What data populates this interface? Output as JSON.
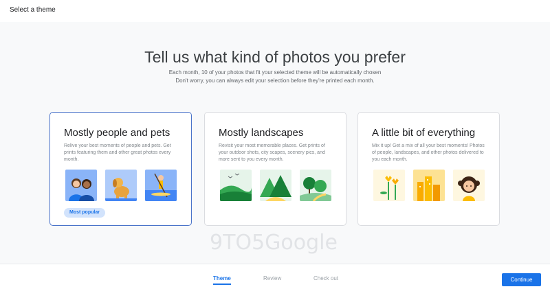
{
  "header": {
    "title": "Select a theme"
  },
  "main": {
    "headline": "Tell us what kind of photos you prefer",
    "subtitle_line1": "Each month, 10 of your photos that fit your selected theme will be automatically chosen",
    "subtitle_line2": "Don't worry, you can always edit your selection before they're printed each month."
  },
  "cards": [
    {
      "title": "Mostly people and pets",
      "description": "Relive your best moments of people and pets. Get prints featuring them and other great photos every month.",
      "badge": "Most popular",
      "selected": true,
      "thumbnails": [
        "people-icon",
        "dog-icon",
        "paddleboard-icon"
      ]
    },
    {
      "title": "Mostly landscapes",
      "description": "Revisit your most memorable places. Get prints of your outdoor shots, city scapes, scenery pics, and more sent to you every month.",
      "selected": false,
      "thumbnails": [
        "hills-icon",
        "mountains-icon",
        "trees-icon"
      ]
    },
    {
      "title": "A little bit of everything",
      "description": "Mix it up! Get a mix of all your best moments! Photos of people, landscapes, and other photos delivered to you each month.",
      "selected": false,
      "thumbnails": [
        "flowers-icon",
        "city-icon",
        "girl-icon"
      ]
    }
  ],
  "watermark": "9TO5Google",
  "footer": {
    "steps": [
      "Theme",
      "Review",
      "Check out"
    ],
    "active_step": "Theme",
    "continue_label": "Continue"
  },
  "colors": {
    "accent": "#1a73e8",
    "selected_border": "#4a73c9",
    "badge_bg": "#d2e3fc"
  }
}
